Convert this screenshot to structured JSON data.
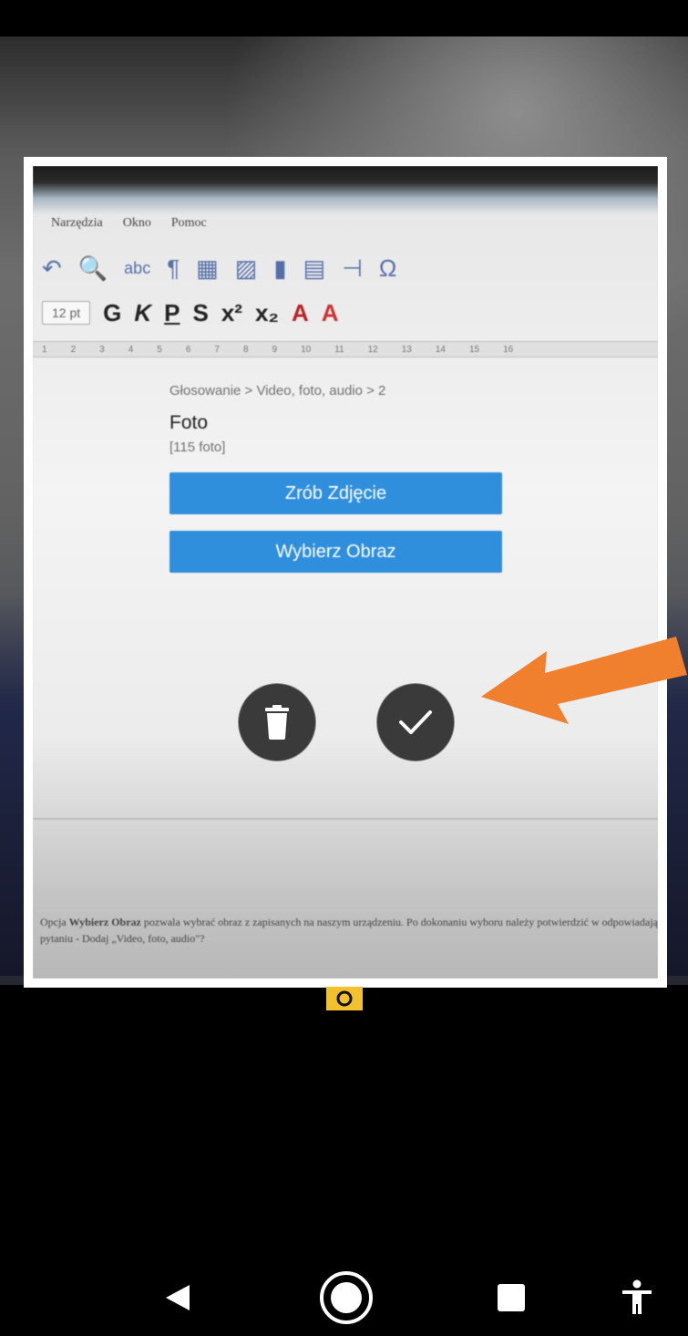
{
  "screen": {
    "background": "#000000"
  },
  "preview": {
    "menu": [
      "Narzędzia",
      "Okno",
      "Pomoc"
    ],
    "font_size_value": "12 pt",
    "format_letters": [
      "G",
      "K",
      "P",
      "S"
    ],
    "superscript": "x²",
    "subscript": "x₂",
    "ruler_ticks": [
      "1",
      "2",
      "3",
      "4",
      "5",
      "6",
      "7",
      "8",
      "9",
      "10",
      "11",
      "12",
      "13",
      "14",
      "15",
      "16"
    ],
    "breadcrumb": "Głosowanie > Video, foto, audio > 2",
    "section_title": "Foto",
    "photo_count": "[115 foto]",
    "take_photo_label": "Zrób Zdjęcie",
    "choose_image_label": "Wybierz Obraz",
    "doc_text_bold": "Wybierz Obraz",
    "doc_text_prefix": "Opcja",
    "doc_text_rest": "pozwala wybrać obraz z zapisanych na naszym urządzeniu. Po dokonaniu wyboru należy potwierdzić w odpowiadający pytaniu - Dodaj „Video, foto, audio\"?"
  },
  "controls": {
    "delete_icon": "trash-icon",
    "confirm_icon": "check-icon"
  },
  "annotation": {
    "arrow_color": "#f07f2e"
  },
  "camera_badge": {
    "label": "O",
    "color": "#f2c12e"
  },
  "navigation": {
    "back_icon": "back-triangle-icon",
    "home_icon": "home-circle-icon",
    "recents_icon": "recents-square-icon",
    "accessibility_icon": "accessibility-icon"
  }
}
